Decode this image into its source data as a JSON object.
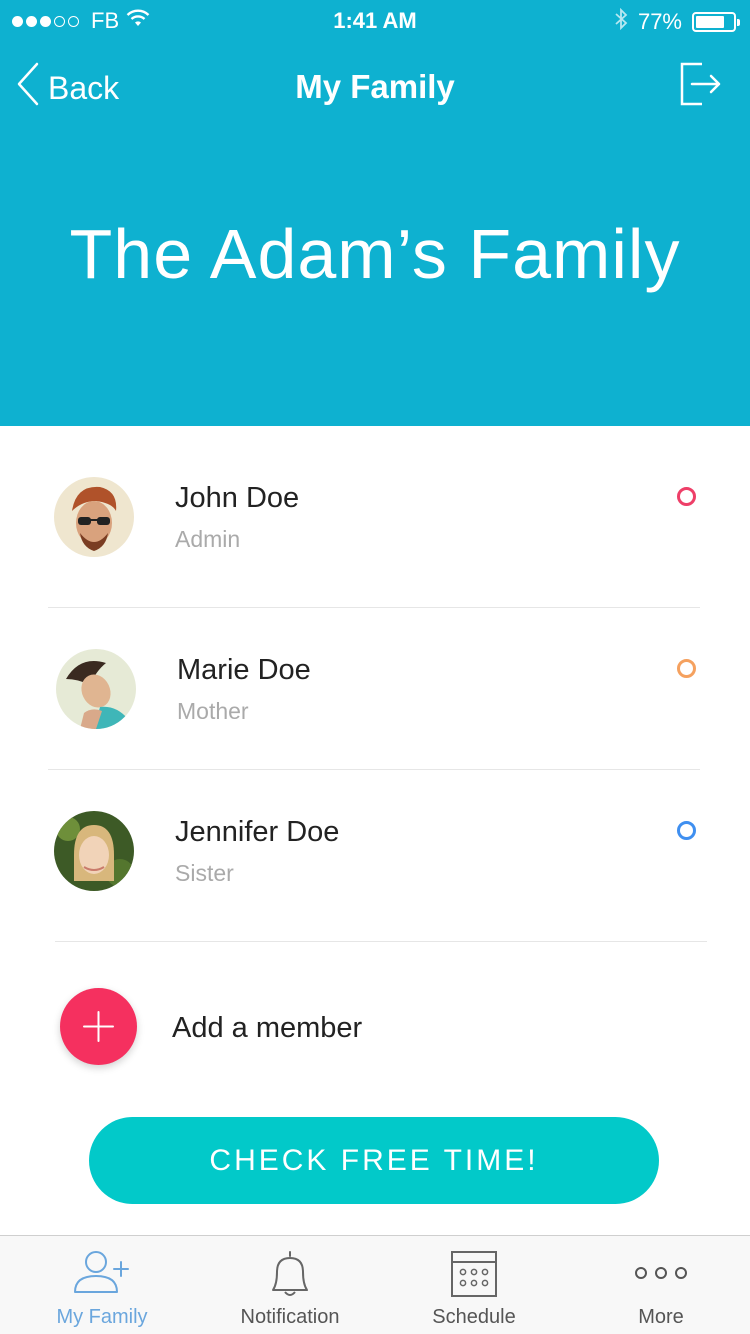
{
  "status_bar": {
    "carrier": "FB",
    "time": "1:41 AM",
    "battery_percent": "77%",
    "battery_level": 0.77,
    "signal_bars_filled": 3,
    "signal_bars_total": 5
  },
  "nav": {
    "back_label": "Back",
    "title": "My Family",
    "exit_icon": "exit-icon"
  },
  "family": {
    "title": "The Adam’s Family"
  },
  "members": [
    {
      "name": "John Doe",
      "role": "Admin",
      "status_color": "#ee3f68"
    },
    {
      "name": "Marie Doe",
      "role": "Mother",
      "status_color": "#f5a15f"
    },
    {
      "name": "Jennifer Doe",
      "role": "Sister",
      "status_color": "#3f8ff0"
    }
  ],
  "add_member": {
    "label": "Add a member",
    "color": "#f5305f"
  },
  "cta": {
    "label": "CHECK FREE TIME!",
    "color": "#02c9c9"
  },
  "tabs": [
    {
      "label": "My Family",
      "icon": "add-user-icon",
      "active": true
    },
    {
      "label": "Notification",
      "icon": "bell-icon",
      "active": false
    },
    {
      "label": "Schedule",
      "icon": "calendar-icon",
      "active": false
    },
    {
      "label": "More",
      "icon": "more-dots-icon",
      "active": false
    }
  ],
  "colors": {
    "header_bg": "#0eb1d0",
    "tab_active": "#6aa6dd",
    "tab_inactive": "#555555"
  }
}
